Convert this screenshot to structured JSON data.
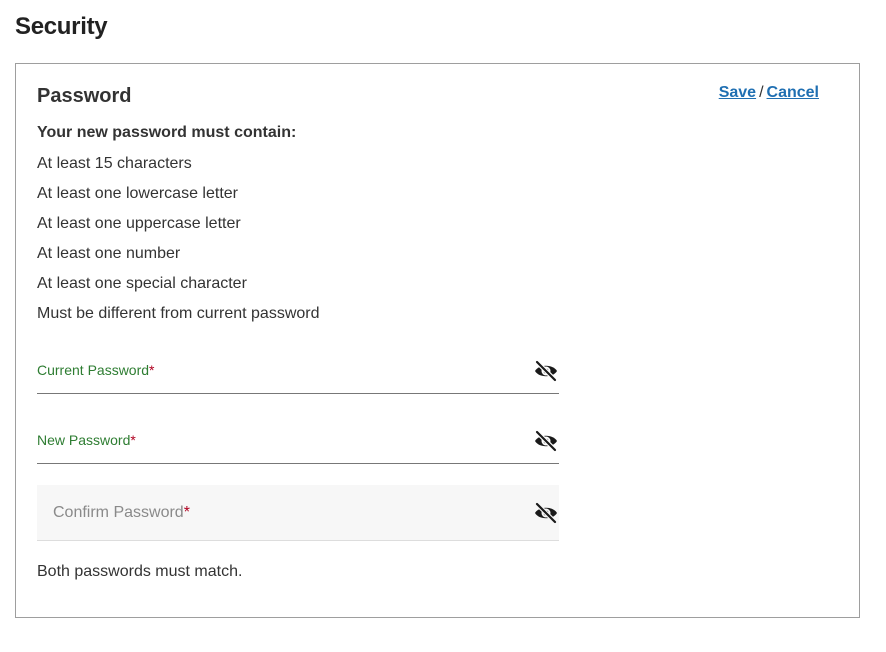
{
  "page": {
    "title": "Security"
  },
  "card": {
    "title": "Password",
    "save_label": "Save",
    "separator": "/",
    "cancel_label": "Cancel",
    "requirements_heading": "Your new password must contain:",
    "requirements": [
      "At least 15 characters",
      "At least one lowercase letter",
      "At least one uppercase letter",
      "At least one number",
      "At least one special character",
      "Must be different from current password"
    ]
  },
  "fields": {
    "current": {
      "label": "Current Password",
      "required_mark": "*",
      "icon": "eye-slash-icon"
    },
    "new": {
      "label": "New Password",
      "required_mark": "*",
      "icon": "eye-slash-icon"
    },
    "confirm": {
      "placeholder": "Confirm Password",
      "required_mark": "*",
      "icon": "eye-slash-icon"
    }
  },
  "hint": "Both passwords must match.",
  "colors": {
    "link": "#1f6fb2",
    "field_label": "#2e7d32",
    "required": "#b00020",
    "border": "#9e9e9e"
  }
}
